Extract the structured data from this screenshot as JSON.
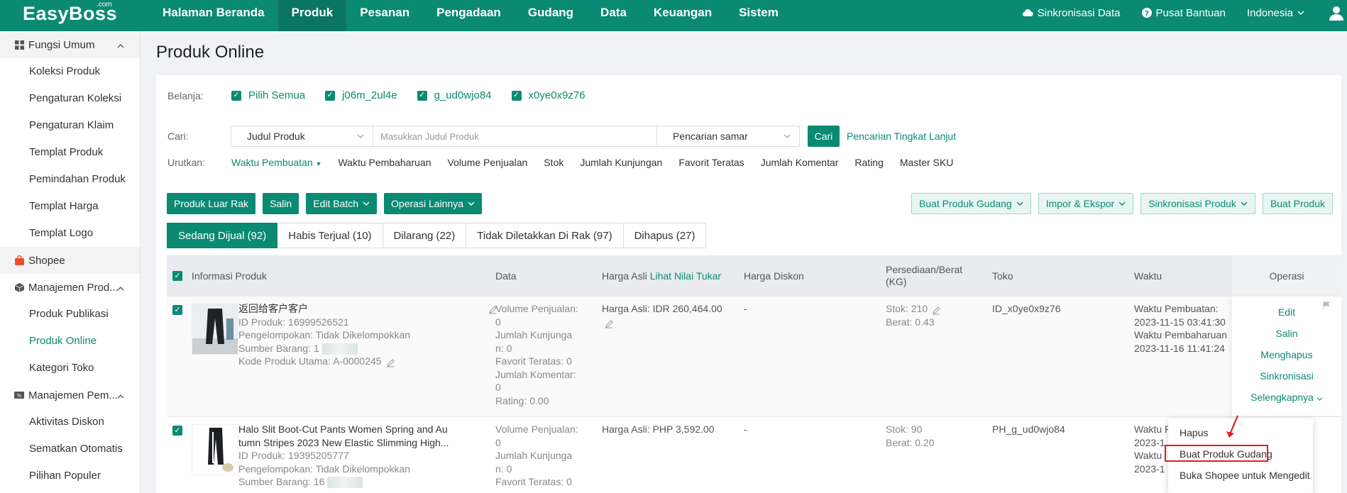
{
  "topbar": {
    "logo": "EasyBoss",
    "logo_sup": ".com",
    "nav": [
      "Halaman Beranda",
      "Produk",
      "Pesanan",
      "Pengadaan",
      "Gudang",
      "Data",
      "Keuangan",
      "Sistem"
    ],
    "active_nav": "Produk",
    "sync": "Sinkronisasi Data",
    "help": "Pusat Bantuan",
    "language": "Indonesia"
  },
  "sidebar": {
    "group1": "Fungsi Umum",
    "group1_items": [
      "Koleksi Produk",
      "Pengaturan Koleksi",
      "Pengaturan Klaim",
      "Templat Produk",
      "Pemindahan Produk",
      "Templat Harga",
      "Templat Logo"
    ],
    "shopee": "Shopee",
    "group2": "Manajemen Prod...",
    "group2_items": [
      "Produk Publikasi",
      "Produk Online",
      "Kategori Toko"
    ],
    "group3": "Manajemen Pem...",
    "group3_items": [
      "Aktivitas Diskon",
      "Sematkan Otomatis",
      "Pilihan Populer"
    ]
  },
  "page": {
    "title": "Produk Online"
  },
  "filters": {
    "shop_label": "Belanja:",
    "shops": [
      "Pilih Semua",
      "j06m_2ul4e",
      "g_ud0wjo84",
      "x0ye0x9z76"
    ],
    "search_label": "Cari:",
    "search_field": "Judul Produk",
    "search_placeholder": "Masukkan Judul Produk",
    "search_mode": "Pencarian samar",
    "search_button": "Cari",
    "advanced": "Pencarian Tingkat Lanjut",
    "sort_label": "Urutkan:",
    "sort_active": "Waktu Pembuatan",
    "sort_items": [
      "Waktu Pembaharuan",
      "Volume Penjualan",
      "Stok",
      "Jumlah Kunjungan",
      "Favorit Teratas",
      "Jumlah Komentar",
      "Rating",
      "Master SKU"
    ]
  },
  "toolbar": {
    "left": [
      "Produk Luar Rak",
      "Salin",
      "Edit Batch",
      "Operasi Lainnya"
    ],
    "right": [
      "Buat Produk Gudang",
      "Impor & Ekspor",
      "Sinkronisasi Produk",
      "Buat Produk"
    ]
  },
  "tabs": [
    "Sedang Dijual (92)",
    "Habis Terjual (10)",
    "Dilarang (22)",
    "Tidak Diletakkan Di Rak (97)",
    "Dihapus (27)"
  ],
  "table": {
    "headers": {
      "info": "Informasi Produk",
      "data": "Data",
      "price": "Harga Asli",
      "price_link": "Lihat Nilai Tukar",
      "discount": "Harga Diskon",
      "stock_1": "Persediaan/Berat",
      "stock_2": "(KG)",
      "shop": "Toko",
      "time": "Waktu",
      "op": "Operasi"
    },
    "row1": {
      "title": "返回给客户客户",
      "id": "ID Produk:  16999526521",
      "group": "Pengelompokan:  Tidak Dikelompokkan",
      "source": "Sumber Barang:   1",
      "code": "Kode Produk Utama:  A-0000245",
      "data": [
        "Volume Penjualan:",
        "0",
        "Jumlah Kunjunga",
        "n:   0",
        "Favorit Teratas:   0",
        "Jumlah Komentar:",
        "0",
        "Rating:   0.00"
      ],
      "price": "Harga Asli:   IDR 260,464.00",
      "discount": "-",
      "stock": "Stok:   210",
      "weight": "Berat:   0.43",
      "shop": "ID_x0ye0x9z76",
      "time": [
        "Waktu Pembuatan:",
        "2023-11-15 03:41:30",
        "Waktu Pembaharuan",
        "2023-11-16 11:41:24"
      ],
      "ops": [
        "Edit",
        "Salin",
        "Menghapus",
        "Sinkronisasi",
        "Selengkapnya"
      ]
    },
    "row2": {
      "title_1": "Halo Slit Boot-Cut Pants Women Spring and Au",
      "title_2": "tumn Stripes 2023 New Elastic Slimming High...",
      "id": "ID Produk:  19395205777",
      "group": "Pengelompokan:  Tidak Dikelompokkan",
      "source": "Sumber Barang:   16",
      "data": [
        "Volume Penjualan:",
        "0",
        "Jumlah Kunjunga",
        "n:   0",
        "Favorit Teratas:   0"
      ],
      "price": "Harga Asli:   PHP 3,592.00",
      "discount": "-",
      "stock": "Stok:   90",
      "weight": "Berat:   0.20",
      "shop": "PH_g_ud0wjo84",
      "time": [
        "Waktu P",
        "2023-1",
        "Waktu",
        "2023-1"
      ]
    }
  },
  "dropdown": [
    "Hapus",
    "Buat Produk Gudang",
    "Buka Shopee untuk Mengedit"
  ],
  "colors": {
    "brand": "#0a8a73",
    "highlight": "#e02020"
  }
}
